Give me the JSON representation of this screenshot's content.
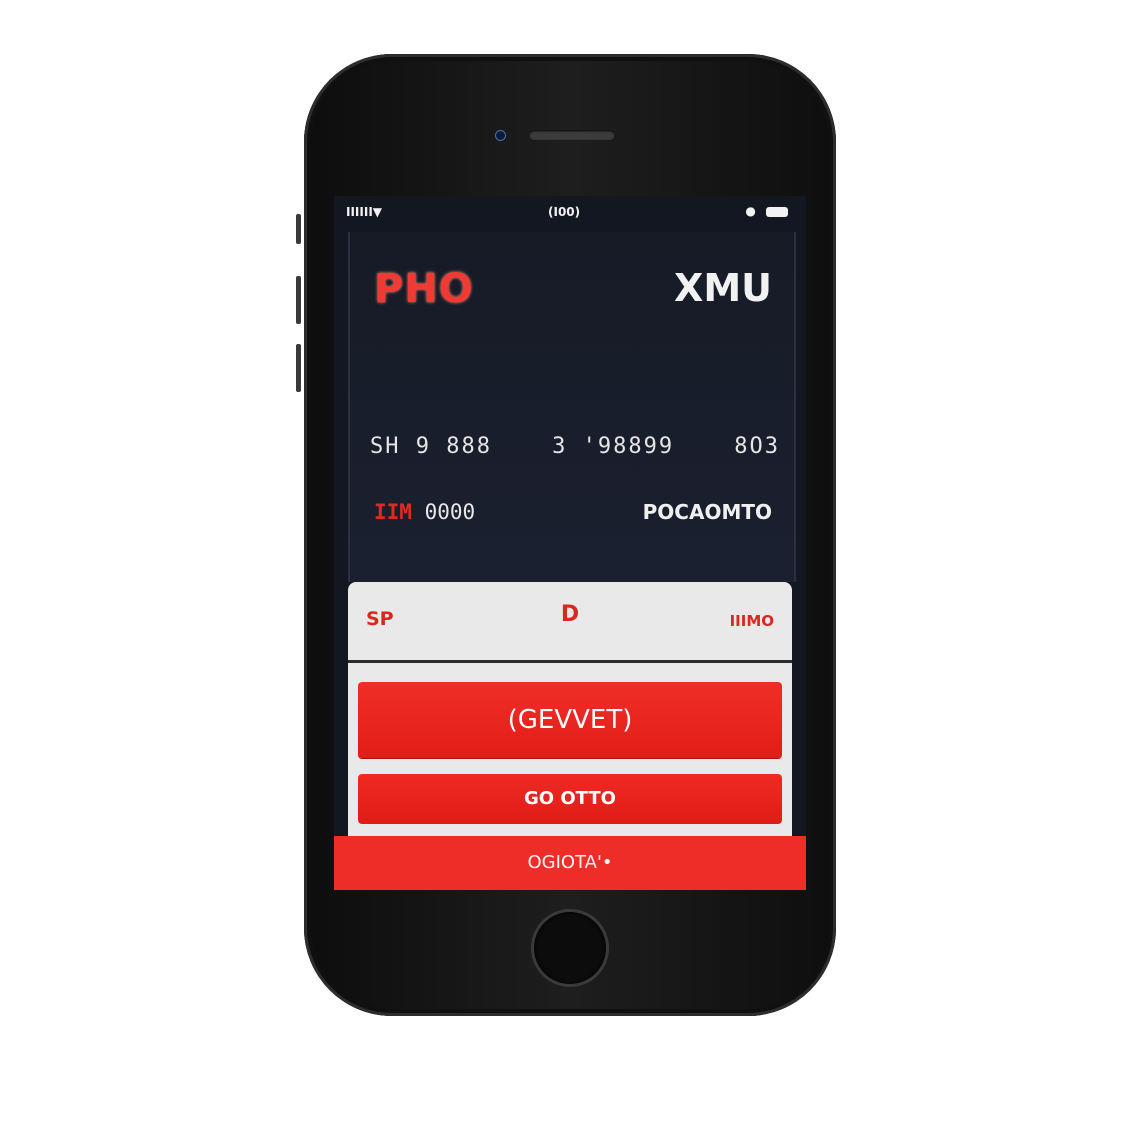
{
  "status_bar": {
    "carrier": "IIIIII▼",
    "time": "(I00)",
    "battery_dot": "●"
  },
  "card": {
    "brand": "PHO",
    "logo": "XMU",
    "number_groups": [
      "SH 9 888",
      "3 '98899",
      "8O3"
    ],
    "expiry_prefix": "IIM",
    "expiry_value": "0000",
    "holder": "POCAOMTO"
  },
  "sheet": {
    "left_label": "SP",
    "center_label": "D",
    "right_label": "IIIMO",
    "primary_button": "(GEVVET)",
    "secondary_button": "GO OTTO",
    "tertiary_button": "OGIOTA'•"
  },
  "colors": {
    "accent_red": "#e21d17",
    "screen_bg": "#131722",
    "sheet_bg": "#e9e9e9",
    "device_body": "#141414"
  }
}
